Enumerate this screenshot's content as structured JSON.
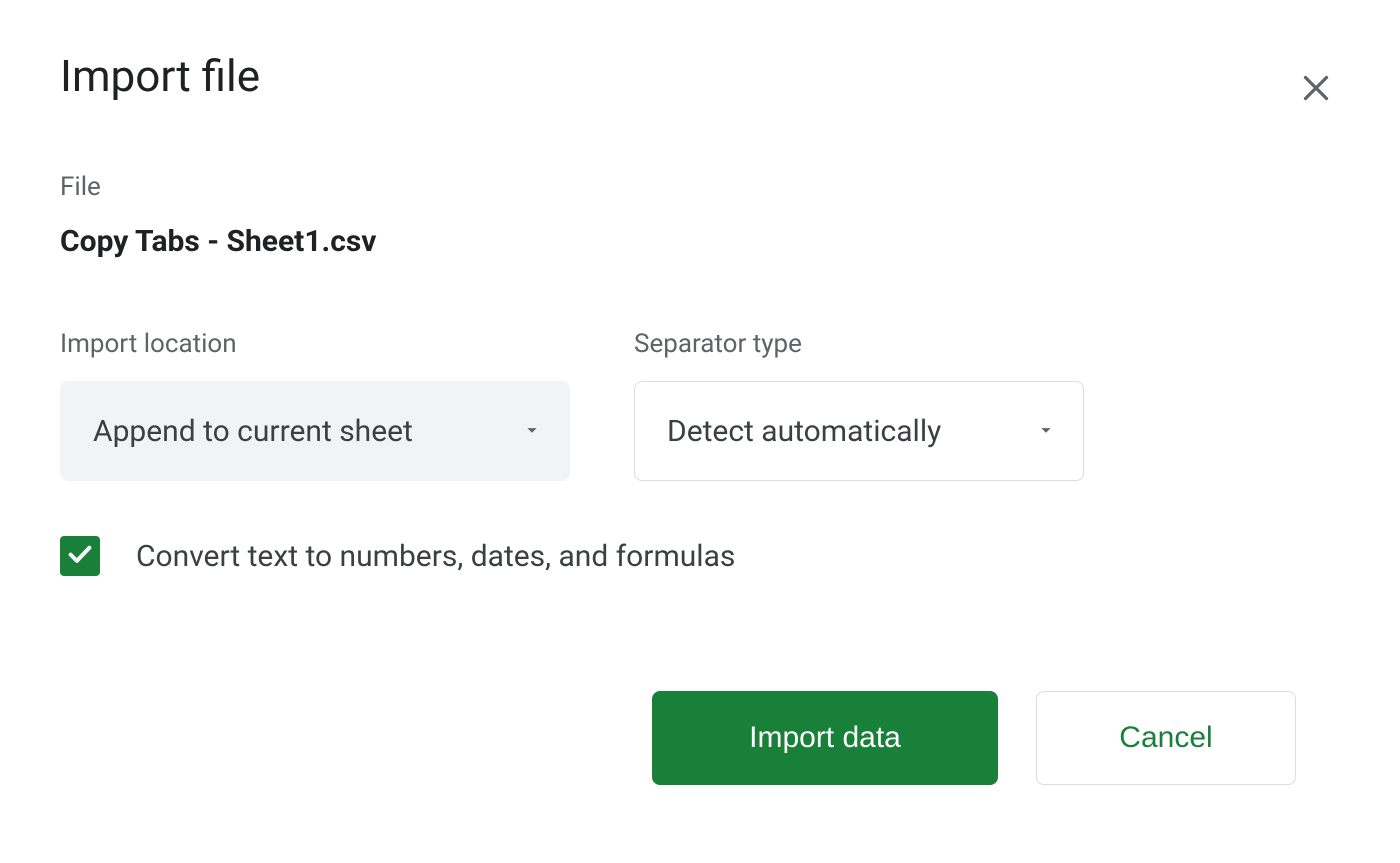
{
  "dialog": {
    "title": "Import file",
    "file_label": "File",
    "file_name": "Copy Tabs - Sheet1.csv",
    "import_location_label": "Import location",
    "import_location_value": "Append to current sheet",
    "separator_type_label": "Separator type",
    "separator_type_value": "Detect automatically",
    "convert_checkbox_checked": true,
    "convert_checkbox_label": "Convert text to numbers, dates, and formulas",
    "primary_button": "Import data",
    "secondary_button": "Cancel"
  }
}
